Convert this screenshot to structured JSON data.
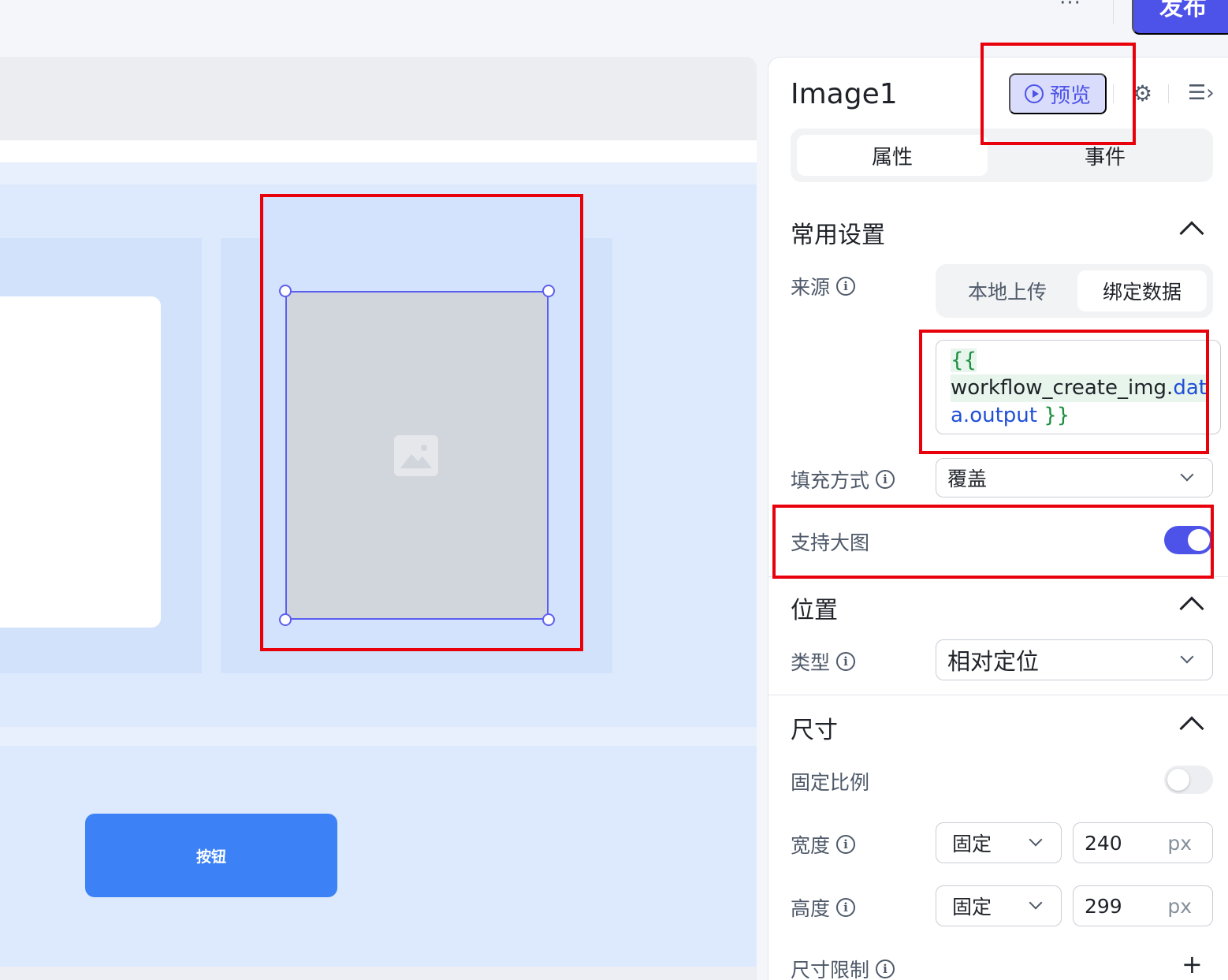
{
  "topbar": {
    "more_label": "···",
    "publish_label": "发布"
  },
  "canvas": {
    "button_label": "按钮"
  },
  "panel": {
    "component_name": "Image1",
    "preview_label": "预览",
    "tabs": [
      {
        "label": "属性",
        "active": true
      },
      {
        "label": "事件",
        "active": false
      }
    ],
    "common": {
      "title": "常用设置",
      "source_label": "来源",
      "source_options": [
        "本地上传",
        "绑定数据"
      ],
      "source_selected": "绑定数据",
      "binding": {
        "line1": "{{",
        "line2_var": "workflow_create_img.",
        "line2_prop": "dat",
        "line3_prop": "a.output",
        "line3_close": " }}"
      },
      "fill_label": "填充方式",
      "fill_value": "覆盖",
      "large_image_label": "支持大图",
      "large_image_enabled": true
    },
    "position": {
      "title": "位置",
      "type_label": "类型",
      "type_value": "相对定位"
    },
    "size": {
      "title": "尺寸",
      "fixed_ratio_label": "固定比例",
      "fixed_ratio_enabled": false,
      "width_label": "宽度",
      "width_mode": "固定",
      "width_value": "240",
      "height_label": "高度",
      "height_mode": "固定",
      "height_value": "299",
      "unit": "px",
      "limit_label": "尺寸限制",
      "limit_add": "+"
    }
  },
  "icons": {
    "info": "i",
    "gear": "⚙",
    "collapse": "☰›"
  },
  "colors": {
    "accent": "#4d53e8",
    "canvas_button": "#3c82f6",
    "annotation": "#e8000b"
  }
}
